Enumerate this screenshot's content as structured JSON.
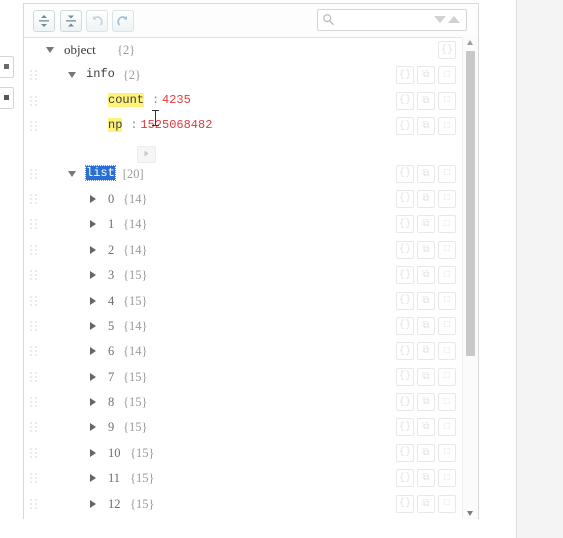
{
  "toolbar": {
    "buttons": [
      {
        "name": "expand-all-button",
        "icon": "expand-vertical-icon",
        "title": "Expand all"
      },
      {
        "name": "collapse-all-button",
        "icon": "collapse-vertical-icon",
        "title": "Collapse all"
      },
      {
        "name": "undo-button",
        "icon": "undo-arrow-icon",
        "title": "Undo"
      },
      {
        "name": "redo-button",
        "icon": "redo-arrow-icon",
        "title": "Redo"
      }
    ],
    "search": {
      "placeholder": "",
      "value": "",
      "icon": "search-icon",
      "next_icon": "triangle-down-icon",
      "prev_icon": "triangle-up-icon"
    }
  },
  "row_actions": {
    "format_label": "{}",
    "duplicate_label": "⧉",
    "remove_label": "□"
  },
  "tree": {
    "nodes": [
      {
        "key": "object",
        "count": "{2}",
        "indent": 0,
        "caret": "open",
        "type": "object",
        "grip": false
      },
      {
        "key": "info",
        "count": "{2}",
        "indent": 1,
        "caret": "open",
        "type": "object",
        "grip": true,
        "mono": true
      },
      {
        "key": "count",
        "value": "4235",
        "indent": 2,
        "caret": "none",
        "type": "value",
        "grip": true,
        "mono": true,
        "highlight": true
      },
      {
        "key": "np",
        "value": "1525068482",
        "indent": 2,
        "caret": "none",
        "type": "value",
        "grip": true,
        "mono": true,
        "highlight": true
      },
      {
        "key": "list",
        "count": "[20]",
        "indent": 1,
        "caret": "open",
        "type": "array",
        "grip": true,
        "mono": true,
        "highlight": true,
        "selected": true
      },
      {
        "key": "0",
        "count": "{14}",
        "indent": 2,
        "caret": "closed",
        "type": "index",
        "grip": true
      },
      {
        "key": "1",
        "count": "{14}",
        "indent": 2,
        "caret": "closed",
        "type": "index",
        "grip": true
      },
      {
        "key": "2",
        "count": "{14}",
        "indent": 2,
        "caret": "closed",
        "type": "index",
        "grip": true
      },
      {
        "key": "3",
        "count": "{15}",
        "indent": 2,
        "caret": "closed",
        "type": "index",
        "grip": true
      },
      {
        "key": "4",
        "count": "{15}",
        "indent": 2,
        "caret": "closed",
        "type": "index",
        "grip": true
      },
      {
        "key": "5",
        "count": "{14}",
        "indent": 2,
        "caret": "closed",
        "type": "index",
        "grip": true
      },
      {
        "key": "6",
        "count": "{14}",
        "indent": 2,
        "caret": "closed",
        "type": "index",
        "grip": true
      },
      {
        "key": "7",
        "count": "{15}",
        "indent": 2,
        "caret": "closed",
        "type": "index",
        "grip": true
      },
      {
        "key": "8",
        "count": "{15}",
        "indent": 2,
        "caret": "closed",
        "type": "index",
        "grip": true
      },
      {
        "key": "9",
        "count": "{15}",
        "indent": 2,
        "caret": "closed",
        "type": "index",
        "grip": true
      },
      {
        "key": "10",
        "count": "{15}",
        "indent": 2,
        "caret": "closed",
        "type": "index",
        "grip": true
      },
      {
        "key": "11",
        "count": "{15}",
        "indent": 2,
        "caret": "closed",
        "type": "index",
        "grip": true
      },
      {
        "key": "12",
        "count": "{15}",
        "indent": 2,
        "caret": "closed",
        "type": "index",
        "grip": true
      }
    ],
    "separator": ":",
    "append_button_icon": "add-item-icon"
  },
  "colors": {
    "value_red": "#e23b3b",
    "highlight_yellow": "#fff27a",
    "selection_blue": "#2a6fd4",
    "key_gray": "#3b3b3b",
    "count_gray": "#9a9a9a"
  },
  "scrollbar": {
    "up_icon": "scroll-up-arrow-icon",
    "down_icon": "scroll-down-arrow-icon"
  },
  "edge_buttons": [
    {
      "name": "left-edge-button-1",
      "icon": "square-icon"
    },
    {
      "name": "left-edge-button-2",
      "icon": "square-filled-icon"
    }
  ]
}
